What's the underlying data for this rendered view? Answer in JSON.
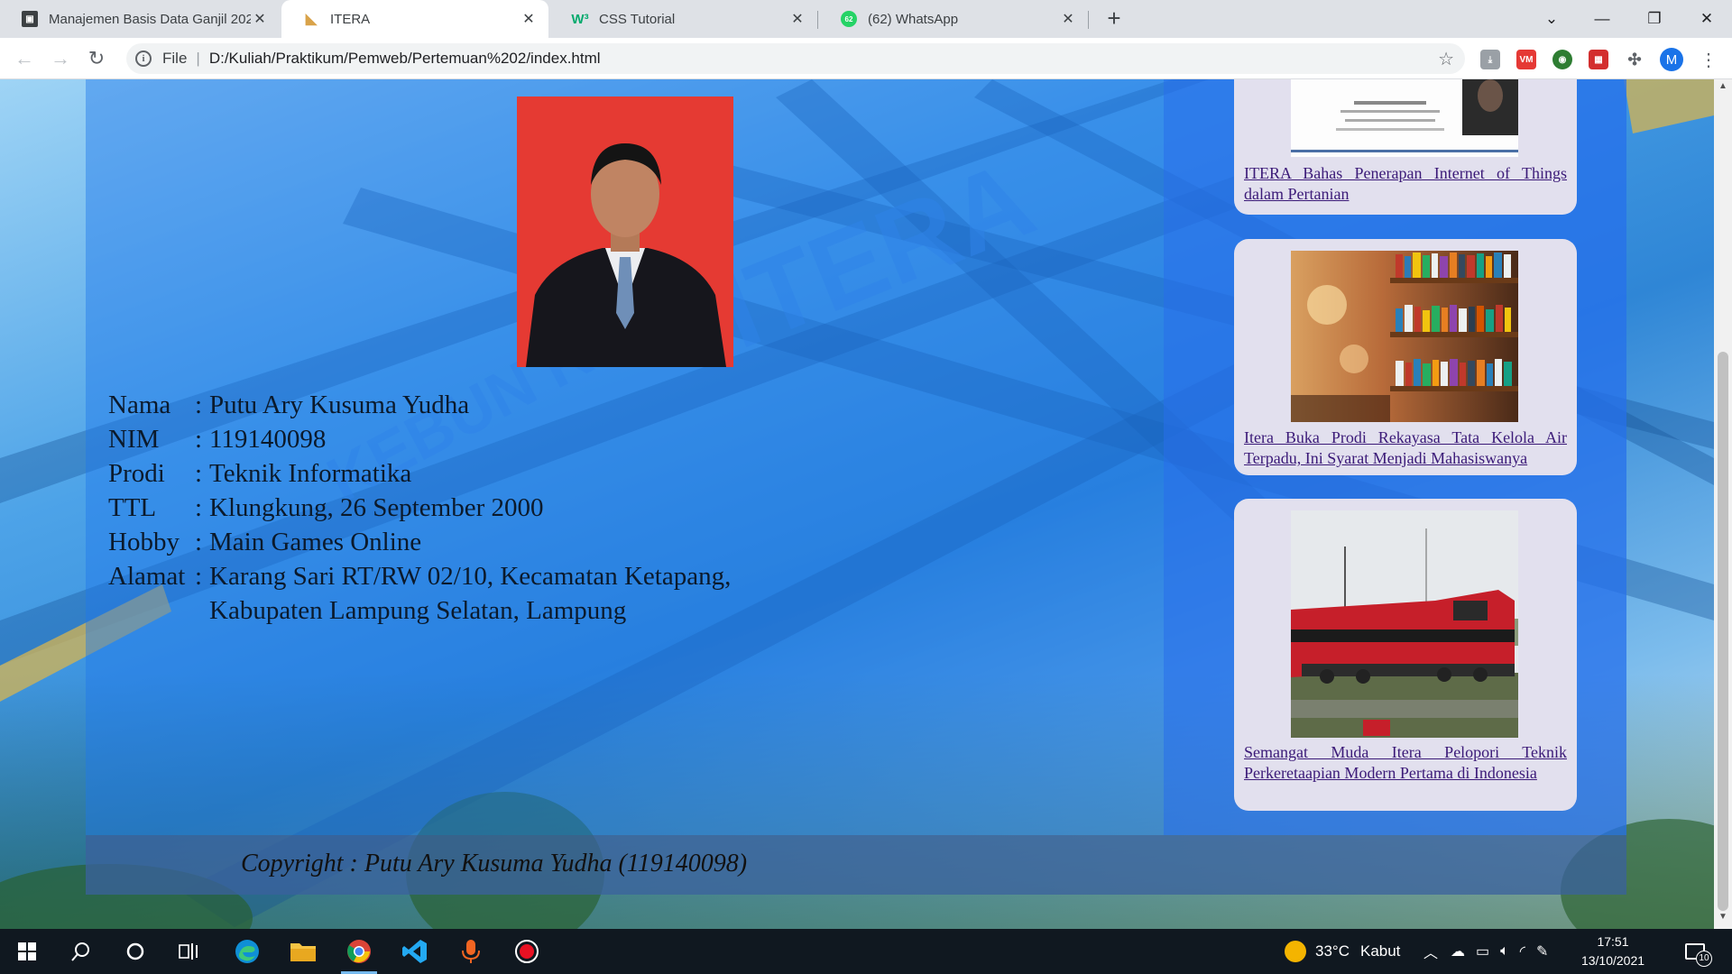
{
  "browser": {
    "tabs": [
      {
        "title": "Manajemen Basis Data Ganjil 202",
        "active": false
      },
      {
        "title": "ITERA",
        "active": true
      },
      {
        "title": "CSS Tutorial",
        "active": false
      },
      {
        "title": "(62) WhatsApp",
        "active": false
      }
    ],
    "address": {
      "scheme_label": "File",
      "url": "D:/Kuliah/Praktikum/Pemweb/Pertemuan%202/index.html"
    },
    "profile_initial": "M",
    "whatsapp_badge": "62"
  },
  "page": {
    "profile": [
      {
        "label": "Nama",
        "value": "Putu Ary Kusuma Yudha"
      },
      {
        "label": "NIM",
        "value": "119140098"
      },
      {
        "label": "Prodi",
        "value": "Teknik Informatika"
      },
      {
        "label": "TTL",
        "value": "Klungkung, 26 September 2000"
      },
      {
        "label": "Hobby",
        "value": "Main Games Online"
      },
      {
        "label": "Alamat",
        "value": "Karang Sari RT/RW 02/10, Kecamatan Ketapang,",
        "continuation": "Kabupaten Lampung Selatan, Lampung"
      }
    ],
    "news": [
      {
        "title": "ITERA Bahas Penerapan Internet of Things dalam Pertanian"
      },
      {
        "title": "Itera Buka Prodi Rekayasa Tata Kelola Air Terpadu, Ini Syarat Menjadi Mahasiswanya"
      },
      {
        "title": "Semangat Muda Itera Pelopori Teknik Perkeretaapian Modern Pertama di Indonesia"
      }
    ],
    "footer": "Copyright : Putu Ary Kusuma Yudha (119140098)",
    "background_sign": "ITERA",
    "background_sign_partial": "KEBUN RAYA"
  },
  "taskbar": {
    "weather_temp": "33°C",
    "weather_desc": "Kabut",
    "time": "17:51",
    "date": "13/10/2021",
    "notifications": "10"
  }
}
